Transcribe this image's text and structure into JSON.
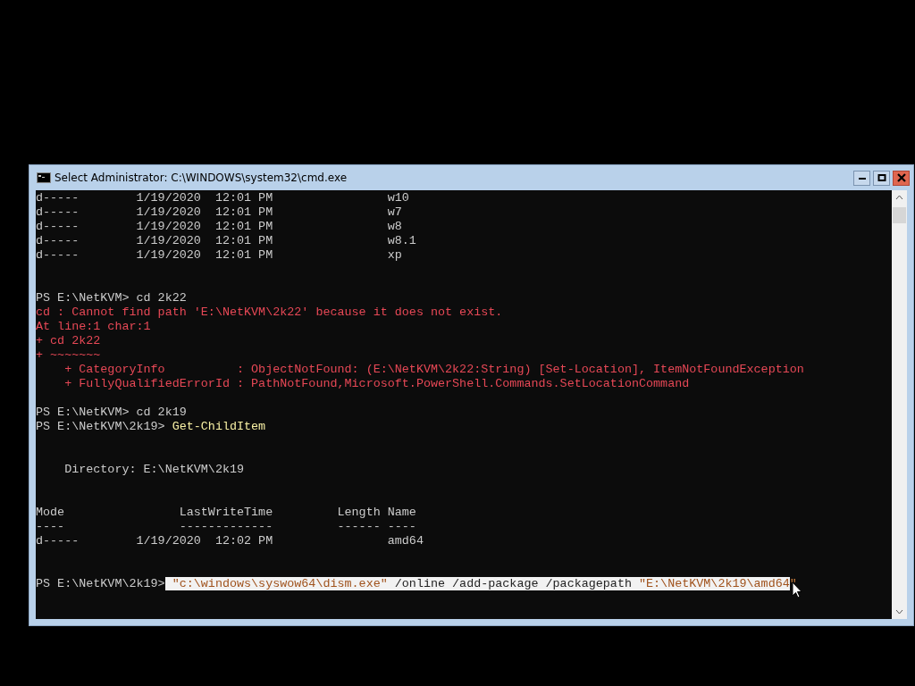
{
  "window": {
    "title": "Select Administrator: C:\\WINDOWS\\system32\\cmd.exe"
  },
  "lines": [
    {
      "kind": "output",
      "text": "d-----        1/19/2020  12:01 PM                w10"
    },
    {
      "kind": "output",
      "text": "d-----        1/19/2020  12:01 PM                w7"
    },
    {
      "kind": "output",
      "text": "d-----        1/19/2020  12:01 PM                w8"
    },
    {
      "kind": "output",
      "text": "d-----        1/19/2020  12:01 PM                w8.1"
    },
    {
      "kind": "output",
      "text": "d-----        1/19/2020  12:01 PM                xp"
    },
    {
      "kind": "blank"
    },
    {
      "kind": "blank"
    },
    {
      "kind": "prompt",
      "segments": [
        {
          "kind": "prompt",
          "text": "PS E:\\NetKVM> ",
          "selected": false
        },
        {
          "kind": "plain",
          "text": "cd 2k22",
          "selected": false
        }
      ]
    },
    {
      "kind": "error",
      "text": "cd : Cannot find path 'E:\\NetKVM\\2k22' because it does not exist."
    },
    {
      "kind": "error",
      "text": "At line:1 char:1"
    },
    {
      "kind": "error",
      "text": "+ cd 2k22"
    },
    {
      "kind": "error",
      "text": "+ ~~~~~~~"
    },
    {
      "kind": "error",
      "text": "    + CategoryInfo          : ObjectNotFound: (E:\\NetKVM\\2k22:String) [Set-Location], ItemNotFoundException"
    },
    {
      "kind": "error",
      "text": "    + FullyQualifiedErrorId : PathNotFound,Microsoft.PowerShell.Commands.SetLocationCommand"
    },
    {
      "kind": "blank"
    },
    {
      "kind": "prompt",
      "segments": [
        {
          "kind": "prompt",
          "text": "PS E:\\NetKVM> ",
          "selected": false
        },
        {
          "kind": "plain",
          "text": "cd 2k19",
          "selected": false
        }
      ]
    },
    {
      "kind": "prompt",
      "segments": [
        {
          "kind": "prompt",
          "text": "PS E:\\NetKVM\\2k19> ",
          "selected": false
        },
        {
          "kind": "command",
          "text": "Get-ChildItem",
          "selected": false
        }
      ]
    },
    {
      "kind": "blank"
    },
    {
      "kind": "blank"
    },
    {
      "kind": "output",
      "text": "    Directory: E:\\NetKVM\\2k19"
    },
    {
      "kind": "blank"
    },
    {
      "kind": "blank"
    },
    {
      "kind": "output",
      "text": "Mode                LastWriteTime         Length Name"
    },
    {
      "kind": "output",
      "text": "----                -------------         ------ ----"
    },
    {
      "kind": "output",
      "text": "d-----        1/19/2020  12:02 PM                amd64"
    },
    {
      "kind": "blank"
    },
    {
      "kind": "blank"
    },
    {
      "kind": "prompt",
      "segments": [
        {
          "kind": "prompt",
          "text": "PS E:\\NetKVM\\2k19>",
          "selected": false
        },
        {
          "kind": "string",
          "text": " \"c:\\windows\\syswow64\\dism.exe\"",
          "selected": true
        },
        {
          "kind": "parameter",
          "text": " /online /add-package /packagepath ",
          "selected": true
        },
        {
          "kind": "string",
          "text": "\"E:\\NetKVM\\2k19\\amd64",
          "selected": true
        },
        {
          "kind": "string",
          "text": "\"",
          "selected": false
        }
      ]
    }
  ]
}
